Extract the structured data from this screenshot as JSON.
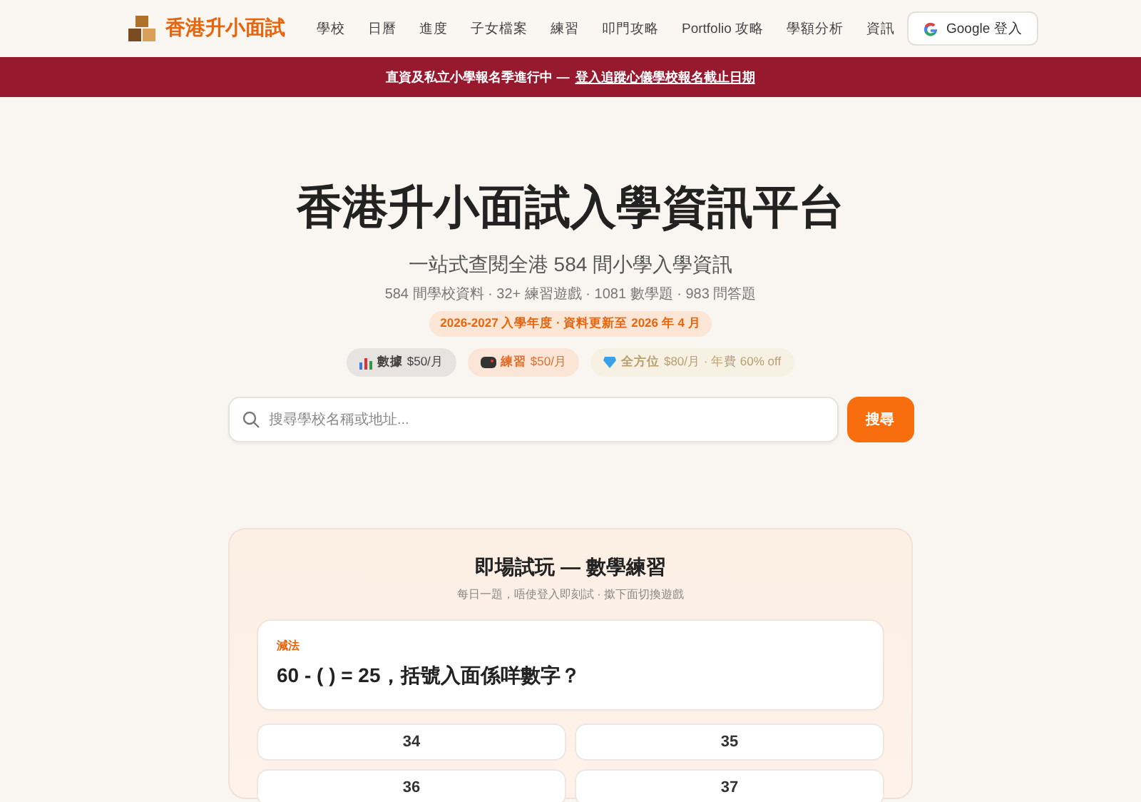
{
  "header": {
    "brand": "香港升小面試",
    "nav": [
      {
        "label": "學校"
      },
      {
        "label": "日曆"
      },
      {
        "label": "進度"
      },
      {
        "label": "子女檔案"
      },
      {
        "label": "練習"
      },
      {
        "label": "叩門攻略"
      },
      {
        "label": "Portfolio 攻略"
      },
      {
        "label": "學額分析"
      },
      {
        "label": "資訊"
      }
    ],
    "login": "Google 登入"
  },
  "banner": {
    "text": "直資及私立小學報名季進行中 —",
    "link": "登入追蹤心儀學校報名截止日期"
  },
  "hero": {
    "title": "香港升小面試入學資訊平台",
    "subtitle": "一站式查閱全港 584 間小學入學資訊",
    "stats": "584 間學校資料 · 32+ 練習遊戲 · 1081 數學題 · 983 問答題",
    "badge": "2026-2027 入學年度 · 資料更新至 2026 年 4 月",
    "plans": [
      {
        "kind": "chart",
        "name": "數據",
        "price": "$50/月"
      },
      {
        "kind": "game",
        "name": "練習",
        "price": "$50/月"
      },
      {
        "kind": "gem",
        "name": "全方位",
        "price": "$80/月 · 年費 60% off"
      }
    ]
  },
  "search": {
    "placeholder": "搜尋學校名稱或地址...",
    "button": "搜尋"
  },
  "practice": {
    "title": "即場試玩 — 數學練習",
    "subtitle": "每日一題，唔使登入即刻試 · 撳下面切換遊戲",
    "category": "減法",
    "question": "60 - ( ) = 25，括號入面係咩數字？",
    "options": [
      "34",
      "35",
      "36",
      "37"
    ]
  }
}
